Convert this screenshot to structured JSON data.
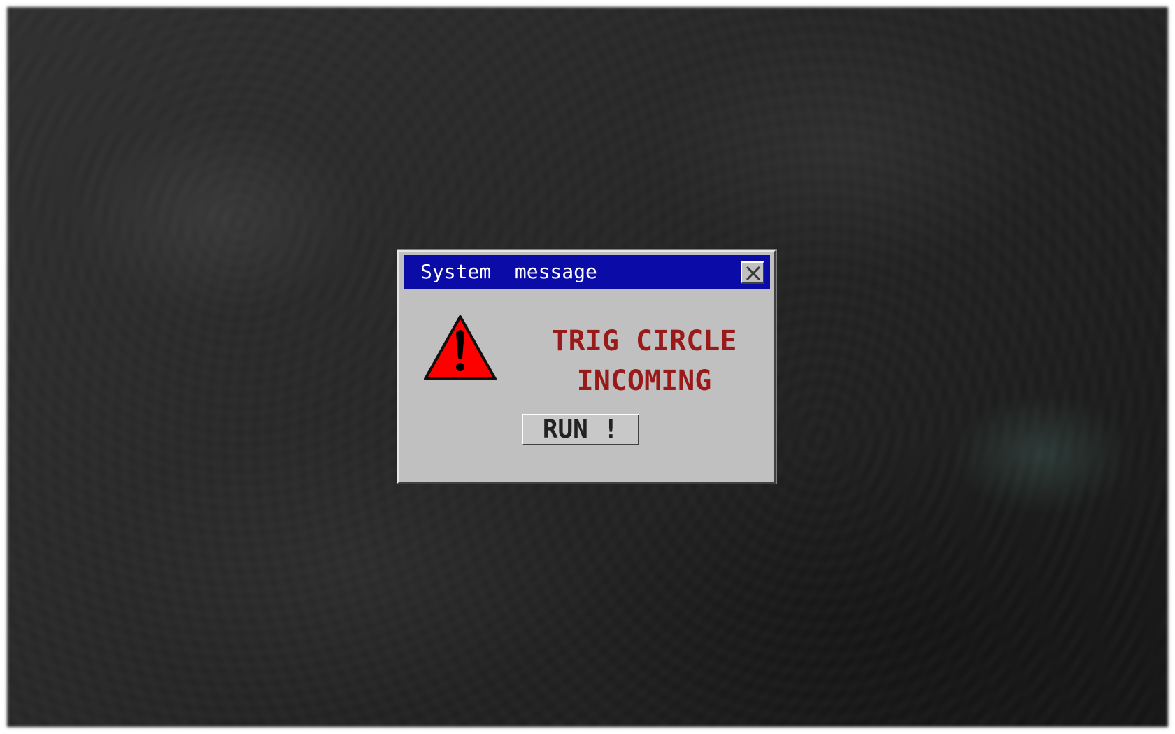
{
  "dialog": {
    "title": "System  message",
    "close_icon": "close-x-icon",
    "warning_icon": "warning-triangle-icon",
    "message_line1": "TRIG CIRCLE",
    "message_line2": "INCOMING",
    "button_label": "RUN !"
  },
  "colors": {
    "titlebar": "#0b0ba8",
    "dialog_bg": "#c0c0c0",
    "message_text": "#9a1a1a",
    "warning_red": "#ff0000"
  }
}
